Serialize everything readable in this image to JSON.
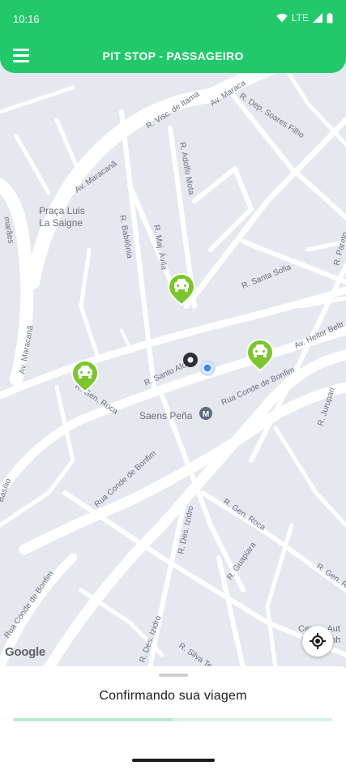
{
  "status_bar": {
    "time": "10:16",
    "network": "LTE"
  },
  "app_bar": {
    "title": "PIT STOP - PASSAGEIRO",
    "menu_icon": "hamburger-menu-icon"
  },
  "map": {
    "street_labels": [
      "R. Visc. de Itama",
      "Av. Maraca",
      "R. Dep. Soares Filho",
      "Av. Maracanã",
      "R. Adolfo Mota",
      "Praça Luis",
      "La Saigne",
      "R. Babilônia",
      "R. Maj. Ávila",
      "R. Santa Sofia",
      "R. Pareto",
      "marães",
      "Av. Maracanã",
      "Av. Heitor Beltr",
      "R. Santo Afon",
      "Rua Conde de Bonfim",
      "R. Gen. Roca",
      "R. Jurupari",
      "Saens Peña",
      "Rua Conde de Bonfim",
      "Basílio",
      "R. Des. Izidro",
      "R. Gen. Roca",
      "R. Guapiara",
      "R. Gen. Ro",
      "Rua Conde de Bonfim",
      "R. Des. Izidro",
      "R. Silva Te",
      "Centro Aut",
      "Nos Senh"
    ],
    "station_badge": "M",
    "car_icon": "car-icon",
    "origin_icon": "origin-marker-icon",
    "user_location_icon": "user-location-icon",
    "google_logo": "Google",
    "locate_icon": "crosshair-icon"
  },
  "bottom_sheet": {
    "title": "Confirmando sua viagem",
    "progress": 0.5
  },
  "colors": {
    "brand": "#22c96b",
    "car_pin": "#7cc52d",
    "map_bg": "#e5e8ef",
    "road": "#ffffff",
    "label": "#68707d",
    "user_dot": "#4285f4"
  }
}
